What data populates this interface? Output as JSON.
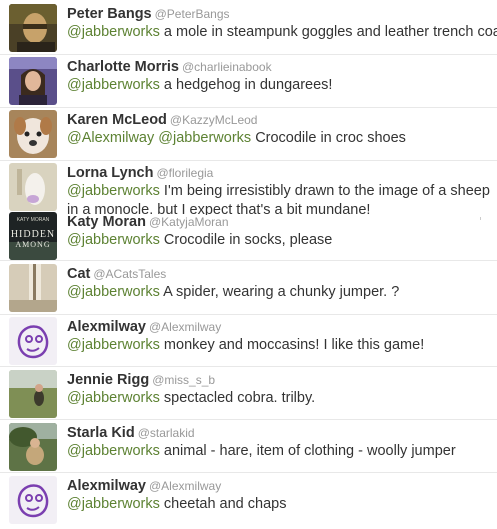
{
  "tweets": [
    {
      "name": "Peter Bangs",
      "handle": "@PeterBangs",
      "mentions": [
        "@jabberworks"
      ],
      "text": "a mole in steampunk goggles and leather trench coat",
      "avatar": "avatar-peter-bangs"
    },
    {
      "name": "Charlotte Morris",
      "handle": "@charlieinabook",
      "mentions": [
        "@jabberworks"
      ],
      "text": "a hedgehog in dungarees!",
      "avatar": "avatar-charlotte-morris"
    },
    {
      "name": "Karen McLeod",
      "handle": "@KazzyMcLeod",
      "mentions": [
        "@Alexmilway",
        "@jabberworks"
      ],
      "text": "Crocodile in croc shoes",
      "avatar": "avatar-karen-mcleod"
    },
    {
      "name": "Lorna Lynch",
      "handle": "@florilegia",
      "mentions": [
        "@jabberworks"
      ],
      "text": "I'm being irresistibly drawn to the image of a sheep in a monocle. but I expect that's a bit mundane!",
      "avatar": "avatar-lorna-lynch"
    },
    {
      "name": "Katy Moran",
      "handle": "@KatyjaMoran",
      "mentions": [
        "@jabberworks"
      ],
      "text": "Crocodile in socks, please",
      "avatar": "avatar-katy-moran",
      "avatar_text": [
        "KATY MORAN",
        "HIDDEN",
        "AMONG"
      ]
    },
    {
      "name": "Cat",
      "handle": "@ACatsTales",
      "mentions": [
        "@jabberworks"
      ],
      "text": "A spider, wearing a chunky jumper. ?",
      "avatar": "avatar-cat"
    },
    {
      "name": "Alexmilway",
      "handle": "@Alexmilway",
      "mentions": [
        "@jabberworks"
      ],
      "text": "monkey and moccasins! I like this game!",
      "avatar": "avatar-alexmilway-doodle"
    },
    {
      "name": "Jennie Rigg",
      "handle": "@miss_s_b",
      "mentions": [
        "@jabberworks"
      ],
      "text": "spectacled cobra. trilby.",
      "avatar": "avatar-jennie-rigg"
    },
    {
      "name": "Starla Kid",
      "handle": "@starlakid",
      "mentions": [
        "@jabberworks"
      ],
      "text": "animal - hare, item of clothing - woolly jumper",
      "avatar": "avatar-starla-kid"
    },
    {
      "name": "Alexmilway",
      "handle": "@Alexmilway",
      "mentions": [
        "@jabberworks"
      ],
      "text": "cheetah and chaps",
      "avatar": "avatar-alexmilway-doodle"
    }
  ],
  "colors": {
    "mention": "#5d8233",
    "name": "#333333",
    "handle": "#999999",
    "text": "#333333"
  }
}
